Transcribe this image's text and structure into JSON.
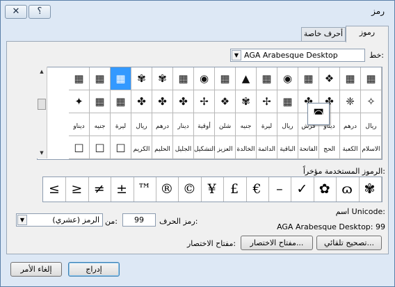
{
  "window": {
    "title": "رمز",
    "close_glyph": "✕",
    "help_glyph": "؟"
  },
  "tabs": [
    {
      "label": "رموز"
    },
    {
      "label": "أحرف خاصة"
    }
  ],
  "font": {
    "label": "خط:",
    "value": "AGA Arabesque Desktop"
  },
  "grid": {
    "rows": [
      [
        "▦",
        "▦",
        "❖",
        "▦",
        "◉",
        "▦",
        "▲",
        "▦",
        "◉",
        "▦",
        "✾",
        "✾",
        "▦",
        "▦",
        "▦"
      ],
      [
        "✧",
        "❈",
        "✤",
        "✤",
        "▦",
        "✢",
        "✾",
        "❖",
        "✢",
        "✤",
        "✤",
        "✤",
        "▦",
        "▦",
        "✦"
      ],
      [
        "ريال",
        "درهم",
        "ديناو",
        "قرش",
        "ريال",
        "ليرة",
        "جنيه",
        "شلن",
        "أوقية",
        "دينار",
        "درهم",
        "ريال",
        "ليرة",
        "جنيه",
        "ديناو"
      ],
      [
        "الاسلام",
        "الكعبة",
        "الحج",
        "الفاتحة",
        "الباقية",
        "الدائمة",
        "الخالدة",
        "العزيز",
        "التشكيل",
        "الجليل",
        "الحليم",
        "الكريم",
        "□",
        "□",
        "□"
      ]
    ],
    "selected": {
      "row": 0,
      "col": 12
    }
  },
  "recent": {
    "label": "الرموز المستخدمة مؤخراً:",
    "symbols": [
      "✾",
      "ɷ",
      "✿",
      "✓",
      "–",
      "€",
      "£",
      "¥",
      "©",
      "®",
      "™",
      "±",
      "≠",
      "≥",
      "≤"
    ]
  },
  "unicode": {
    "name_label": "اسم Unicode:",
    "name_value": "AGA Arabesque Desktop: 99"
  },
  "char_code": {
    "label": "رمز الحرف:",
    "value": "99",
    "from_label": "من:",
    "from_value": "الرمز (عشري)"
  },
  "buttons": {
    "autocorrect": "تصحيح تلقائي...",
    "shortcut_key": "مفتاح الاختصار...",
    "shortcut_label": "مفتاح الاختصار:",
    "insert": "إدراج",
    "cancel": "إلغاء الأمر"
  },
  "zoom_glyph": "◚"
}
